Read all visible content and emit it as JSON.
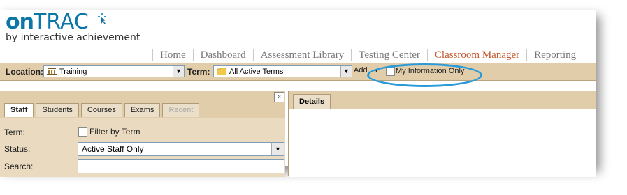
{
  "brand": {
    "name_part1": "on",
    "name_part2": "TRAC",
    "tagline": "by interactive achievement",
    "accent": "#0b76a8"
  },
  "nav": [
    {
      "label": "Home",
      "active": false
    },
    {
      "label": "Dashboard",
      "active": false
    },
    {
      "label": "Assessment Library",
      "active": false
    },
    {
      "label": "Testing Center",
      "active": false
    },
    {
      "label": "Classroom Manager",
      "active": true
    },
    {
      "label": "Reporting",
      "active": false
    }
  ],
  "toolbar": {
    "location_label": "Location:",
    "location_value": "Training",
    "location_icon": "building-icon",
    "term_label": "Term:",
    "term_value": "All Active Terms",
    "term_icon": "folder-icon",
    "add_label": "Add...",
    "my_info_label": "My Information Only",
    "my_info_checked": false
  },
  "left_panel": {
    "collapse_glyph": "«",
    "tabs": [
      {
        "label": "Staff",
        "active": true,
        "disabled": false
      },
      {
        "label": "Students",
        "active": false,
        "disabled": false
      },
      {
        "label": "Courses",
        "active": false,
        "disabled": false
      },
      {
        "label": "Exams",
        "active": false,
        "disabled": false
      },
      {
        "label": "Recent",
        "active": false,
        "disabled": true
      }
    ],
    "term_label": "Term:",
    "filter_label": "Filter by Term",
    "status_label": "Status:",
    "status_value": "Active Staff Only",
    "search_label": "Search:",
    "search_value": ""
  },
  "right_panel": {
    "tab_label": "Details"
  },
  "highlight_color": "#2a9bd8"
}
